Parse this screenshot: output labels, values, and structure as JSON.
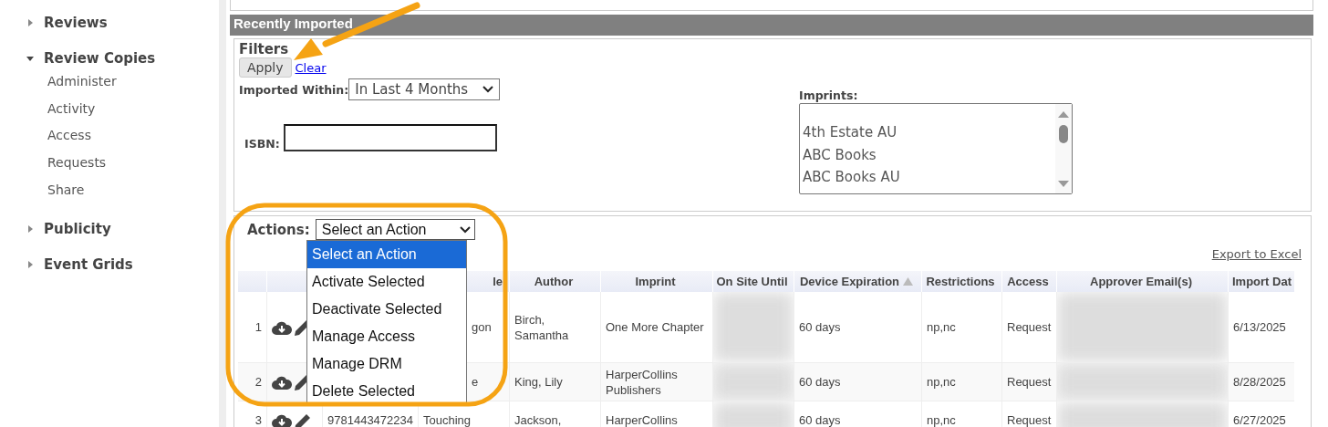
{
  "sidebar": {
    "groups": [
      {
        "label": "Reviews",
        "expanded": false
      },
      {
        "label": "Review Copies",
        "expanded": true,
        "children": [
          {
            "label": "Administer"
          },
          {
            "label": "Activity"
          },
          {
            "label": "Access"
          },
          {
            "label": "Requests"
          },
          {
            "label": "Share"
          }
        ]
      },
      {
        "label": "Publicity",
        "expanded": false
      },
      {
        "label": "Event Grids",
        "expanded": false
      }
    ]
  },
  "panel": {
    "title": "Recently Imported",
    "filters": {
      "title": "Filters",
      "apply": "Apply",
      "clear": "Clear",
      "imported_within": {
        "label": "Imported Within:",
        "value": "In Last 4 Months"
      },
      "isbn": {
        "label": "ISBN:"
      },
      "imprints": {
        "label": "Imprints:",
        "options": [
          "4th Estate AU",
          "ABC Books",
          "ABC Books AU"
        ]
      }
    },
    "actions": {
      "label": "Actions:",
      "value": "Select an Action",
      "expanded": true,
      "options": [
        {
          "label": "Select an Action",
          "selected": true
        },
        {
          "label": "Activate Selected",
          "selected": false
        },
        {
          "label": "Deactivate Selected",
          "selected": false
        },
        {
          "label": "Manage Access",
          "selected": false
        },
        {
          "label": "Manage DRM",
          "selected": false
        },
        {
          "label": "Delete Selected",
          "selected": false
        }
      ]
    },
    "export": "Export to Excel",
    "table": {
      "columns": [
        {},
        {},
        {},
        {
          "label": "le"
        },
        {
          "label": "Author"
        },
        {
          "label": "Imprint"
        },
        {
          "label": "On Site Until"
        },
        {
          "label": "Device Expiration",
          "sorted": true
        },
        {
          "label": "Restrictions"
        },
        {
          "label": "Access"
        },
        {
          "label": "Approver Email(s)"
        },
        {
          "label": "Import Dat"
        }
      ],
      "rows": [
        {
          "number": "1",
          "title": "gon",
          "author": "Birch, Samantha",
          "imprint": "One More Chapter",
          "device_expiration": "60 days",
          "restrictions": "np,nc",
          "access": "Request",
          "import_date": "6/13/2025"
        },
        {
          "number": "2",
          "title": "e",
          "author": "King, Lily",
          "imprint": "HarperCollins Publishers",
          "device_expiration": "60 days",
          "restrictions": "np,nc",
          "access": "Request",
          "import_date": "8/28/2025"
        },
        {
          "number": "3",
          "isbn": "9781443472234",
          "title": "Touching",
          "author": "Jackson,",
          "imprint": "HarperCollins",
          "device_expiration": "60 days",
          "restrictions": "np,nc",
          "access": "Request",
          "import_date": "6/27/2025"
        }
      ]
    }
  }
}
